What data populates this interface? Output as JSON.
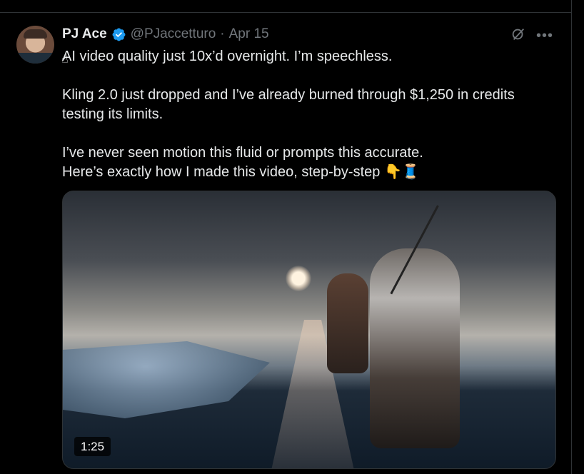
{
  "tweet": {
    "author_name": "PJ Ace",
    "handle": "@PJaccetturo",
    "separator": "·",
    "date": "Apr 15",
    "text": "AI video quality just 10x’d overnight. I’m speechless.\n\nKling 2.0 just dropped and I’ve already burned through $1,250 in credits testing its limits.\n\nI’ve never seen motion this fluid or prompts this accurate.\nHere’s exactly how I made this video, step-by-step 👇🧵",
    "media": {
      "duration": "1:25"
    }
  },
  "icons": {
    "verified": "verified-badge-icon",
    "grok": "grok-icon",
    "more": "more-icon"
  },
  "colors": {
    "background": "#000000",
    "text": "#e7e9ea",
    "muted": "#71767b",
    "verified": "#1d9bf0"
  }
}
